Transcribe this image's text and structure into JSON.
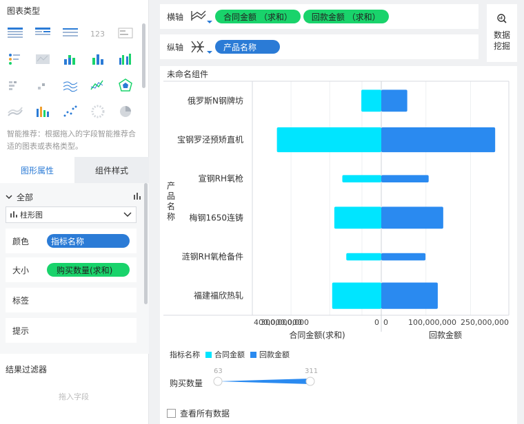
{
  "chart_types": {
    "title": "图表类型",
    "icons": [
      "table-icon",
      "cross-table-icon",
      "detail-table-icon",
      "number-kpi-icon",
      "list-icon",
      "dot-grid-icon",
      "map-icon",
      "stacked-bar-icon",
      "bar-icon",
      "grouped-bar-icon",
      "heat-grid-icon",
      "scatter-grid-icon",
      "line-area-icon",
      "line-icon",
      "radar-icon",
      "area-icon",
      "combo-bar-icon",
      "scatter-icon",
      "bubble-ring-icon",
      "pie-icon"
    ],
    "hint": "智能推荐：根据拖入的字段智能推荐合适的图表或表格类型。"
  },
  "tabs": {
    "shape_props": "图形属性",
    "component_style": "组件样式"
  },
  "props": {
    "all_label": "全部",
    "chart_type_value": "柱形图",
    "color_label": "颜色",
    "color_pill": "指标名称",
    "size_label": "大小",
    "size_pill": "购买数量(求和)",
    "label_label": "标签",
    "tooltip_label": "提示"
  },
  "filter": {
    "title": "结果过滤器",
    "placeholder": "拖入字段"
  },
  "axes": {
    "x_label": "横轴",
    "x_pills": [
      "合同金额 （求和）",
      "回款金额 （求和）"
    ],
    "y_label": "纵轴",
    "y_pills": [
      "产品名称"
    ]
  },
  "mine_button": {
    "line1": "数据",
    "line2": "挖掘"
  },
  "chart_panel": {
    "title": "未命名组件",
    "legend_title": "指标名称",
    "legend_items": [
      "合同金额",
      "回款金额"
    ],
    "size_label": "购买数量",
    "size_min": "63",
    "size_max": "311",
    "checkbox_label": "查看所有数据"
  },
  "colors": {
    "accent_blue": "#2b7bd6",
    "green": "#19d36b",
    "cyan": "#00e5ff",
    "blue": "#2a8af0"
  },
  "chart_data": {
    "type": "bar",
    "orientation": "horizontal-butterfly",
    "ylabel": "产品名称",
    "categories": [
      "俄罗斯N钢牌坊",
      "宝钢罗泾预矫直机",
      "宣钢RH氧枪",
      "梅钢1650连铸",
      "涟钢RH氧枪备件",
      "福建福欣热轧"
    ],
    "series": [
      {
        "name": "合同金额",
        "xlabel": "合同金额(求和)",
        "color": "#00e5ff",
        "values": [
          65000000,
          340000000,
          127000000,
          153000000,
          114000000,
          160000000
        ],
        "bar_size": [
          0.75,
          0.85,
          0.25,
          0.75,
          0.25,
          0.9
        ]
      },
      {
        "name": "回款金额",
        "xlabel": "回款金额",
        "color": "#2a8af0",
        "values": [
          57000000,
          250000000,
          104000000,
          136000000,
          97000000,
          124000000
        ],
        "bar_size": [
          0.75,
          0.85,
          0.25,
          0.75,
          0.25,
          0.9
        ]
      }
    ],
    "left_ticks": [
      "400,000,000",
      "300,000,000",
      "0"
    ],
    "right_ticks": [
      "0",
      "100,000,000",
      "250,000,000"
    ],
    "left_xlim": [
      0,
      420000000
    ],
    "right_xlim": [
      0,
      280000000
    ]
  }
}
